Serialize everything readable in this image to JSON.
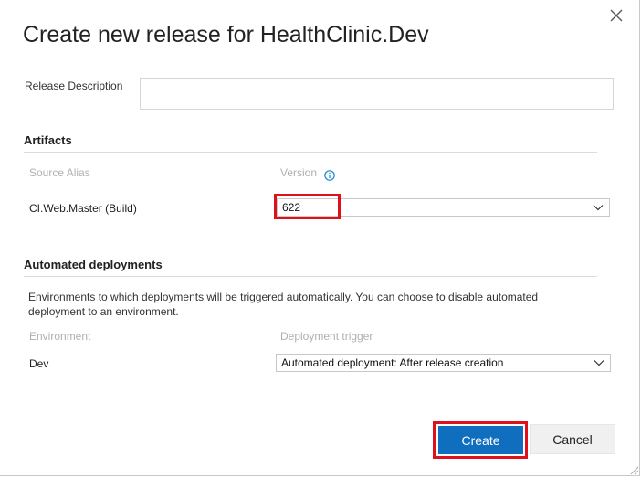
{
  "dialog": {
    "title": "Create new release for HealthClinic.Dev",
    "close_icon": "close-icon"
  },
  "description": {
    "label": "Release Description",
    "value": ""
  },
  "artifacts": {
    "heading": "Artifacts",
    "col_source": "Source Alias",
    "col_version": "Version",
    "info_icon": "info-icon",
    "rows": [
      {
        "source": "CI.Web.Master (Build)",
        "version": "622"
      }
    ]
  },
  "automated": {
    "heading": "Automated deployments",
    "help": "Environments to which deployments will be triggered automatically. You can choose to disable automated deployment to an environment.",
    "col_env": "Environment",
    "col_trigger": "Deployment trigger",
    "rows": [
      {
        "environment": "Dev",
        "trigger": "Automated deployment: After release creation"
      }
    ]
  },
  "buttons": {
    "create": "Create",
    "cancel": "Cancel"
  },
  "colors": {
    "primary": "#106ebe",
    "highlight": "#e0101a",
    "info": "#1a86d0"
  }
}
